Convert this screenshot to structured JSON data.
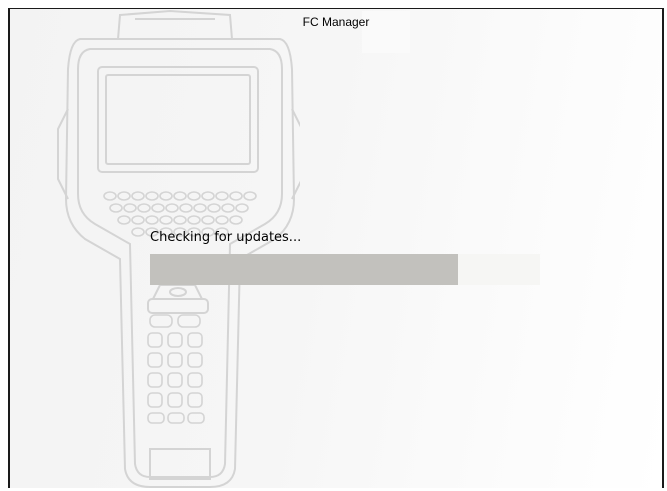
{
  "window": {
    "title": "FC Manager"
  },
  "status": {
    "message": "Checking for updates...",
    "progress_fraction": 0.79
  },
  "background": {
    "illustration": "handheld-communicator-device-illustration"
  },
  "colors": {
    "progress_fill": "#c2c1bd",
    "progress_track": "#f6f6f4",
    "text": "#000000"
  }
}
